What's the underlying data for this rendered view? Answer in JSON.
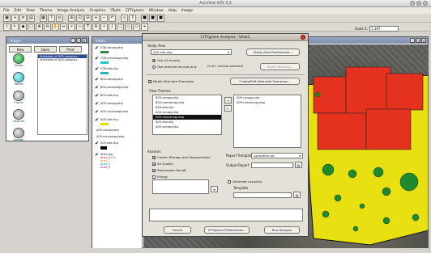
{
  "app": {
    "title": "ArcView GIS 3.2"
  },
  "menu": [
    "File",
    "Edit",
    "View",
    "Theme",
    "Image Analysis",
    "Graphics",
    "ITools",
    "CITYgreen",
    "Window",
    "Help",
    "Image"
  ],
  "scale": {
    "label": "Scale 1:",
    "value": "1,387"
  },
  "catalog": {
    "title": "citygrn",
    "buttons": [
      "New",
      "Open",
      "Print"
    ],
    "icons": [
      "Views",
      "Tables",
      "Charts",
      "Layouts",
      "Scripts"
    ],
    "list": [
      "Attributes of A09-canopy.s...",
      "Attributes of A05-canopy.s..."
    ]
  },
  "view": {
    "title": "View1",
    "legend": [
      {
        "label": "C08-canopy.shp",
        "color": "#2e8b3c"
      },
      {
        "label": "C08-noncanopy.shp",
        "color": "#27c4c4"
      },
      {
        "label": "C08-site.shp",
        "color": "#2fb7b7"
      },
      {
        "label": "B04-canopy.shp",
        "color": ""
      },
      {
        "label": "B04-noncanopy.shp",
        "color": ""
      },
      {
        "label": "B04-site.shp",
        "color": ""
      },
      {
        "label": "A05-canopy.shp",
        "color": ""
      },
      {
        "label": "A05-noncanopy.shp",
        "color": ""
      },
      {
        "label": "A05-site.shp",
        "color": "#e8d800"
      },
      {
        "label": "A09-canopy.shp",
        "color": ""
      },
      {
        "label": "A09-noncanopy.shp",
        "color": ""
      },
      {
        "label": "A09-site.shp",
        "color": "#000000"
      }
    ],
    "area_legend": [
      "Area.shp",
      "Area_0.0.1",
      "Area_1",
      "Area_2",
      "Area_3"
    ]
  },
  "dialog": {
    "title": "CITYgreen Analysis - View1",
    "study_area_label": "Study Area",
    "study_area_value": "A09-site.shp",
    "prefs_button": "Study Area Preferences...",
    "radio_all": "Use all records",
    "radio_selected": "Use selected records only",
    "selected_count": "(0 of 1 records selected)",
    "select_records_button": "Select Records...",
    "model_alt_label": "Model Alternate Scenarios",
    "create_alt_button": "Create/Edit Alternate Scenarios...",
    "view_themes_label": "View Themes",
    "themes": [
      "B04-canopy.shp",
      "B04-noncanopy.shp",
      "B04-site.shp",
      "A05-canopy.shp",
      "A05-noncanopy.shp",
      "A05-site.shp",
      "A09-canopy.shp"
    ],
    "themes_selected_index": 4,
    "chosen": [
      "A09-canopy.shp",
      "A09-noncanopy.shp"
    ],
    "add_arrow": "→",
    "remove_arrow": "←",
    "analysis_label": "Analysis",
    "analysis_items": [
      {
        "label": "Carbon Storage and Sequestration",
        "checked": true
      },
      {
        "label": "Air Quality",
        "checked": true
      },
      {
        "label": "Stormwater Runoff",
        "checked": true
      },
      {
        "label": "Energy",
        "checked": false
      }
    ],
    "report_template_label": "Report Template",
    "report_template_value": "cgreadrev.rpt",
    "output_report_label": "Output Report",
    "output_report_value": "",
    "gen_layout_label": "Generate Layout(s)",
    "template_label": "Template",
    "cancel": "Cancel",
    "prefs": "CITYgreen Preferences...",
    "run": "Run Analysis"
  },
  "colors": {
    "canopy": "#1f8a2d",
    "site": "#e8e010",
    "building": "#e5321e"
  }
}
